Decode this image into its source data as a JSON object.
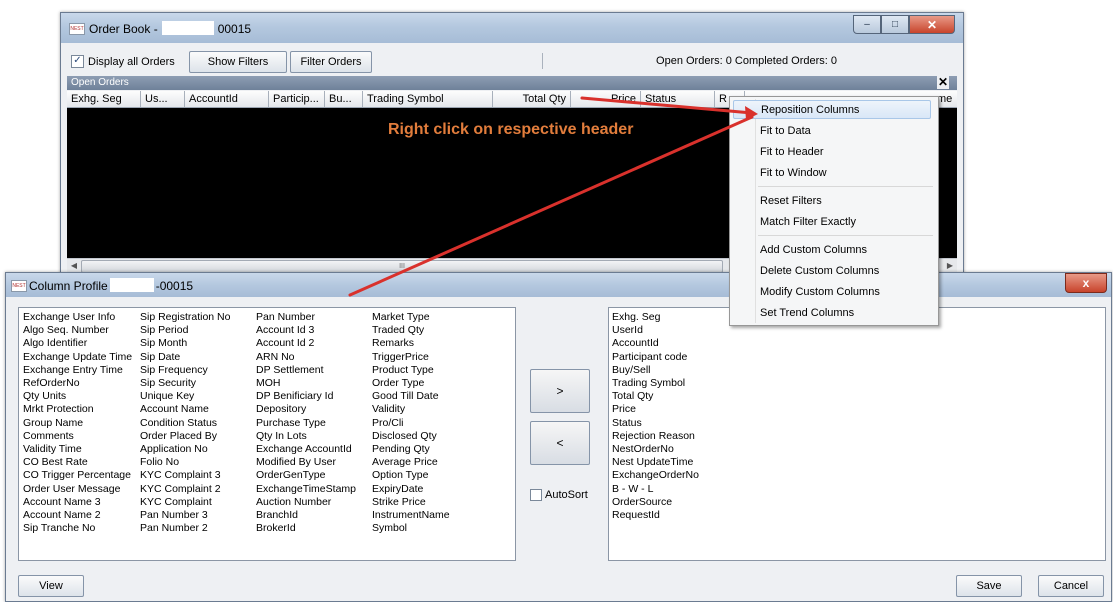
{
  "order_book": {
    "title_prefix": "Order Book -",
    "title_suffix": "00015",
    "display_all_label": "Display all Orders",
    "display_all_checked": true,
    "show_filters_label": "Show Filters",
    "filter_orders_label": "Filter Orders",
    "status": "Open Orders: 0   Completed Orders: 0",
    "open_orders_label": "Open Orders",
    "close_glyph": "✕",
    "columns": [
      "Exhg. Seg",
      "Us...",
      "AccountId",
      "Particip...",
      "Bu...",
      "Trading Symbol",
      "Total Qty",
      "Price",
      "Status",
      "R",
      "me"
    ],
    "scroll_marker": "III",
    "caption_buttons": [
      "–",
      "□",
      "✕"
    ]
  },
  "annotation_text": "Right click on respective header",
  "context_menu": {
    "items": [
      "Reposition Columns",
      "Fit to Data",
      "Fit to Header",
      "Fit to Window",
      "Reset Filters",
      "Match Filter Exactly",
      "Add Custom Columns",
      "Delete Custom Columns",
      "Modify Custom Columns",
      "Set Trend Columns"
    ]
  },
  "column_profile": {
    "title_prefix": "Column Profile",
    "title_suffix": "-00015",
    "close_glyph": "x",
    "available_columns": [
      [
        "Exchange User Info",
        "Algo Seq. Number",
        "Algo Identifier",
        "Exchange Update Time",
        "Exchange Entry Time",
        "RefOrderNo",
        "Qty Units",
        "Mrkt Protection",
        "Group Name",
        "Comments",
        "Validity Time",
        "CO Best Rate",
        "CO Trigger Percentage",
        "Order User Message",
        "Account Name 3",
        "Account Name 2",
        "Sip Tranche No"
      ],
      [
        "Sip Registration No",
        "Sip Period",
        "Sip Month",
        "Sip Date",
        "Sip Frequency",
        "Sip Security",
        "Unique Key",
        "Account Name",
        "Condition Status",
        "Order Placed By",
        "Application No",
        "Folio No",
        "KYC Complaint 3",
        "KYC Complaint 2",
        "KYC Complaint",
        "Pan Number 3",
        "Pan Number 2"
      ],
      [
        "Pan Number",
        "Account Id 3",
        "Account Id 2",
        "ARN No",
        "DP Settlement",
        "MOH",
        "DP Benificiary Id",
        "Depository",
        "Purchase Type",
        "Qty In Lots",
        "Exchange AccountId",
        "Modified By User",
        "OrderGenType",
        "ExchangeTimeStamp",
        "Auction Number",
        "BranchId",
        "BrokerId"
      ],
      [
        "Market Type",
        "Traded Qty",
        "Remarks",
        "TriggerPrice",
        "Product Type",
        "Order Type",
        "Good Till Date",
        "Validity",
        "Pro/Cli",
        "Disclosed Qty",
        "Pending Qty",
        "Average Price",
        "Option Type",
        "ExpiryDate",
        "Strike Price",
        "InstrumentName",
        "Symbol"
      ]
    ],
    "selected_columns": [
      "Exhg. Seg",
      "UserId",
      "AccountId",
      "Participant code",
      "Buy/Sell",
      "Trading Symbol",
      "Total Qty",
      "Price",
      "Status",
      "Rejection Reason",
      "NestOrderNo",
      "Nest UpdateTime",
      "ExchangeOrderNo",
      "B - W - L",
      "OrderSource",
      "RequestId"
    ],
    "move_right_label": ">",
    "move_left_label": "<",
    "autosort_label": "AutoSort",
    "view_label": "View",
    "save_label": "Save",
    "cancel_label": "Cancel"
  },
  "colors": {
    "annotation": "#e27d3c",
    "arrow": "#d9312c",
    "grid_body": "#000000"
  }
}
